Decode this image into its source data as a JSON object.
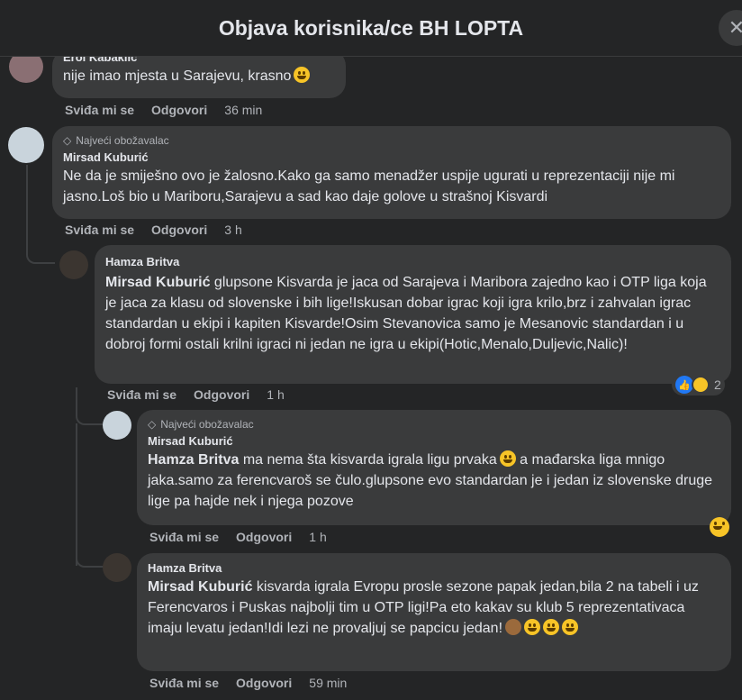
{
  "header": {
    "title": "Objava korisnika/ce BH LOPTA",
    "close_icon": "close-icon"
  },
  "actions_labels": {
    "like": "Sviđa mi se",
    "reply": "Odgovori"
  },
  "comments": [
    {
      "author": "Erol Kabaklic",
      "text": "nije imao mjesta u Sarajevu, krasno",
      "time": "36 min"
    },
    {
      "badge": "Najveći obožavalac",
      "author": "Mirsad Kuburić",
      "text": "Ne da je smiješno ovo je žalosno.Kako ga samo menadžer uspije ugurati u reprezentaciji nije mi jasno.Loš bio u Mariboru,Sarajevu a sad kao daje golove u strašnoj Kisvardi",
      "time": "3 h"
    },
    {
      "author": "Hamza Britva",
      "mention": "Mirsad Kuburić",
      "text": " glupsone Kisvarda je jaca od Sarajeva i Maribora zajedno kao i OTP liga koja je jaca za klasu od slovenske i bih lige!Iskusan dobar igrac koji igra krilo,brz i zahvalan igrac standardan u ekipi i kapiten Kisvarde!Osim Stevanovica samo je Mesanovic standardan i u dobroj formi ostali krilni igraci ni jedan ne igra u ekipi(Hotic,Menalo,Duljevic,Nalic)!",
      "time": "1 h",
      "reaction_count": "2"
    },
    {
      "badge": "Najveći obožavalac",
      "author": "Mirsad Kuburić",
      "mention": "Hamza Britva",
      "text_a": " ma nema šta kisvarda igrala ligu prvaka",
      "text_b": " a mađarska liga mnigo jaka.samo za ferencvaroš se čulo.glupsone evo standardan je i jedan iz slovenske druge lige pa hajde nek i njega pozove",
      "time": "1 h"
    },
    {
      "author": "Hamza Britva",
      "mention": "Mirsad Kuburić",
      "text": " kisvarda igrala Evropu prosle sezone papak jedan,bila 2 na tabeli i uz Ferencvaros i Puskas najbolji tim u OTP ligi!Pa eto kakav su klub 5 reprezentativaca imaju levatu jedan!Idi lezi ne provaljuj se papcicu jedan!",
      "time": "59 min"
    }
  ]
}
